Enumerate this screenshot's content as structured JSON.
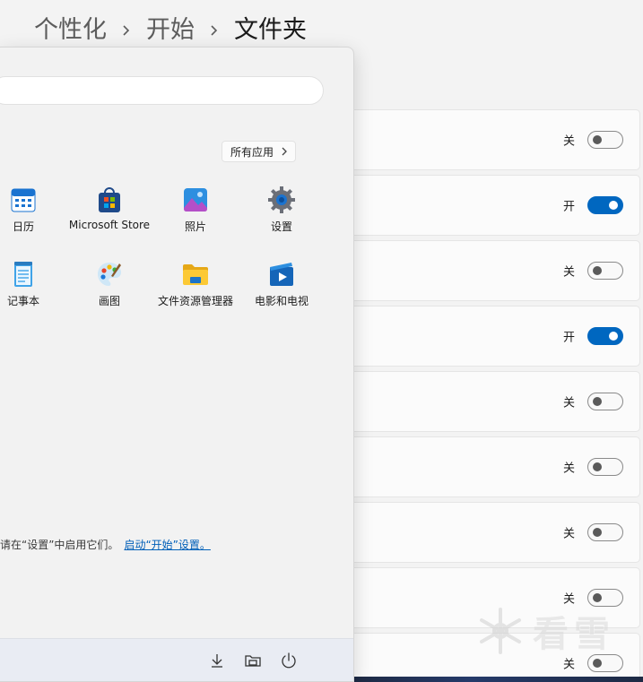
{
  "breadcrumb": {
    "level1": "个性化",
    "level2": "开始",
    "current": "文件夹"
  },
  "settings_rows": [
    {
      "state": "关",
      "on": false
    },
    {
      "state": "开",
      "on": true
    },
    {
      "state": "关",
      "on": false
    },
    {
      "state": "开",
      "on": true
    },
    {
      "state": "关",
      "on": false
    },
    {
      "state": "关",
      "on": false
    },
    {
      "state": "关",
      "on": false
    },
    {
      "state": "关",
      "on": false
    },
    {
      "state": "关",
      "on": false
    }
  ],
  "start_menu": {
    "all_apps_label": "所有应用",
    "pinned_apps": [
      {
        "label": "日历",
        "icon": "calendar-icon"
      },
      {
        "label": "Microsoft Store",
        "icon": "store-icon"
      },
      {
        "label": "照片",
        "icon": "photos-icon"
      },
      {
        "label": "设置",
        "icon": "settings-gear-icon"
      },
      {
        "label": "记事本",
        "icon": "notepad-icon"
      },
      {
        "label": "画图",
        "icon": "paint-icon"
      },
      {
        "label": "文件资源管理器",
        "icon": "file-explorer-icon"
      },
      {
        "label": "电影和电视",
        "icon": "movies-tv-icon"
      }
    ],
    "recommend_text": "请在“设置”中启用它们。",
    "recommend_link": "启动“开始”设置。"
  },
  "watermark": "看雪",
  "colors": {
    "accent": "#0067c0",
    "background": "#f3f3f3",
    "card": "#fbfbfb"
  }
}
